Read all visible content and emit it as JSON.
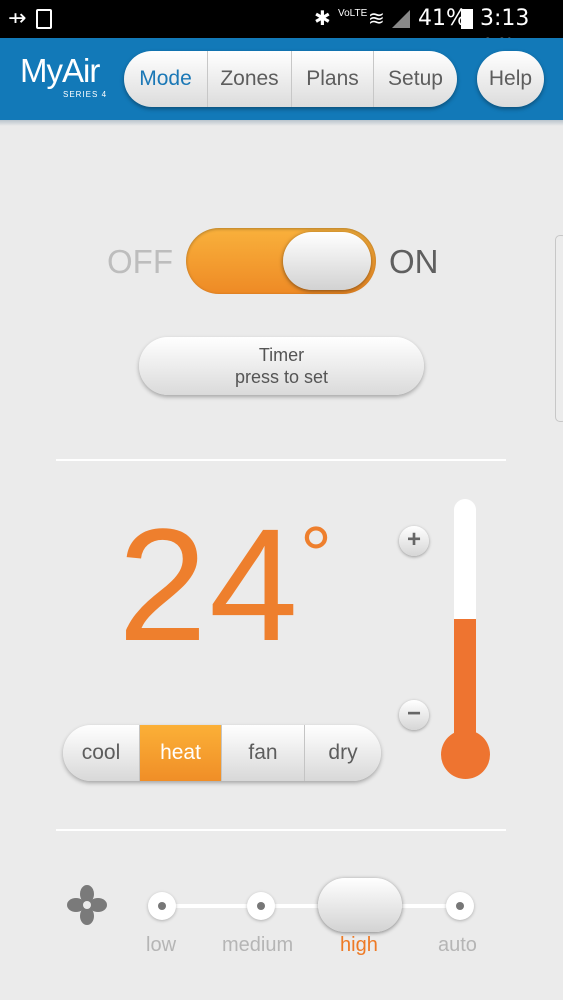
{
  "status_bar": {
    "battery": "41%",
    "time": "3:13 pm",
    "network": "VoLTE"
  },
  "header": {
    "logo": "MyAir",
    "logo_sub": "SERIES 4",
    "tabs": [
      {
        "label": "Mode",
        "active": true
      },
      {
        "label": "Zones"
      },
      {
        "label": "Plans"
      },
      {
        "label": "Setup"
      }
    ],
    "help": "Help"
  },
  "power": {
    "off_label": "OFF",
    "on_label": "ON",
    "state": "on"
  },
  "timer": {
    "line1": "Timer",
    "line2": "press to set"
  },
  "temperature": {
    "value": "24",
    "unit": "°",
    "setpoint_level": 0.52
  },
  "modes": [
    {
      "label": "cool"
    },
    {
      "label": "heat",
      "active": true
    },
    {
      "label": "fan"
    },
    {
      "label": "dry"
    }
  ],
  "controls": {
    "plus": "+",
    "minus": "−"
  },
  "fan": {
    "speeds": [
      "low",
      "medium",
      "high",
      "auto"
    ],
    "selected": "high"
  },
  "colors": {
    "accent": "#ee7f2d",
    "header": "#1279b8",
    "active_tab": "#1b78b6"
  }
}
